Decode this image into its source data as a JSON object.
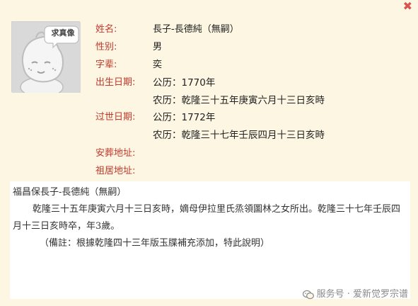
{
  "window": {
    "close_glyph": "✖"
  },
  "avatar": {
    "placeholder_text": "求真像"
  },
  "profile": {
    "name_label": "姓名:",
    "name_value": "長子-長德純（無嗣）",
    "gender_label": "性别:",
    "gender_value": "男",
    "generation_label": "字辈:",
    "generation_value": "奕",
    "birth_label": "出生日期:",
    "birth_gregorian": "公历：1770年",
    "birth_lunar": "农历：乾隆三十五年庚寅六月十三日亥時",
    "death_label": "过世日期:",
    "death_gregorian": "公历：1772年",
    "death_lunar": "农历：乾隆三十七年壬辰四月十三日亥時",
    "burial_label": "安葬地址:",
    "burial_value": "",
    "ancestral_label": "祖居地址:",
    "ancestral_value": ""
  },
  "description": {
    "heading": "福昌保長子-長德純（無嗣）",
    "body": "乾隆三十五年庚寅六月十三日亥時，嫡母伊拉里氏烝領圖林之女所出。乾隆三十七年壬辰四月十三日亥時卒，年3歲。",
    "note": "（備註：根據乾隆四十三年版玉牒補充添加，特此說明）"
  },
  "watermark": {
    "text": "服务号 · 爱新觉罗宗谱",
    "icon": "wechat-icon"
  }
}
